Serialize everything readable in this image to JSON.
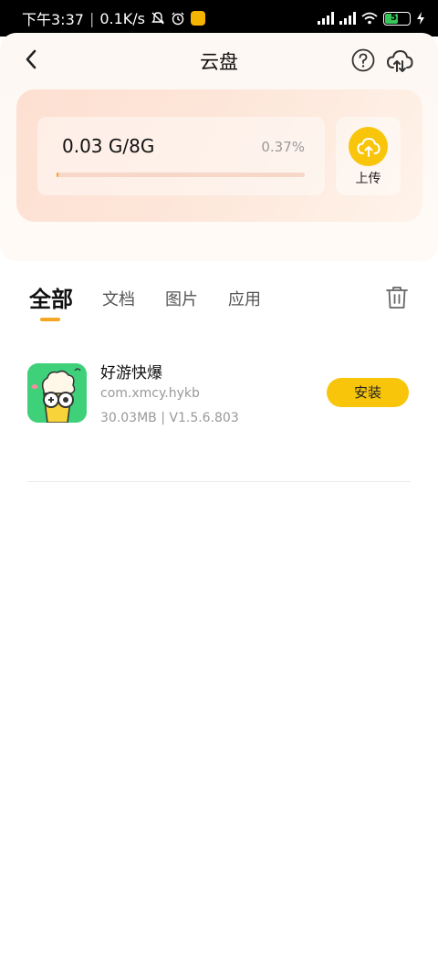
{
  "status_bar": {
    "time": "下午3:37",
    "network_speed": "0.1K/s",
    "battery_level": "55",
    "icons": [
      "bell-muted-icon",
      "alarm-icon",
      "app-notification-icon",
      "signal-icon",
      "signal-icon",
      "wifi-icon",
      "battery-icon",
      "charging-icon"
    ]
  },
  "header": {
    "title": "云盘",
    "icons": [
      "back-icon",
      "help-icon",
      "cloud-upload-icon"
    ]
  },
  "storage": {
    "usage": "0.03 G/8G",
    "percent": "0.37%",
    "fill_fraction": 0.0037,
    "upload_label": "上传"
  },
  "tabs": [
    {
      "label": "全部",
      "active": true
    },
    {
      "label": "文档",
      "active": false
    },
    {
      "label": "图片",
      "active": false
    },
    {
      "label": "应用",
      "active": false
    }
  ],
  "files": [
    {
      "name": "好游快爆",
      "package": "com.xmcy.hykb",
      "meta": "30.03MB | V1.5.6.803",
      "action": "安装"
    }
  ],
  "colors": {
    "accent": "#f8c50b",
    "indicator": "#f5a623",
    "card_gradient_start": "#fde0d2",
    "card_gradient_end": "#fff3ea",
    "app_icon_bg": "#3fd07a"
  }
}
